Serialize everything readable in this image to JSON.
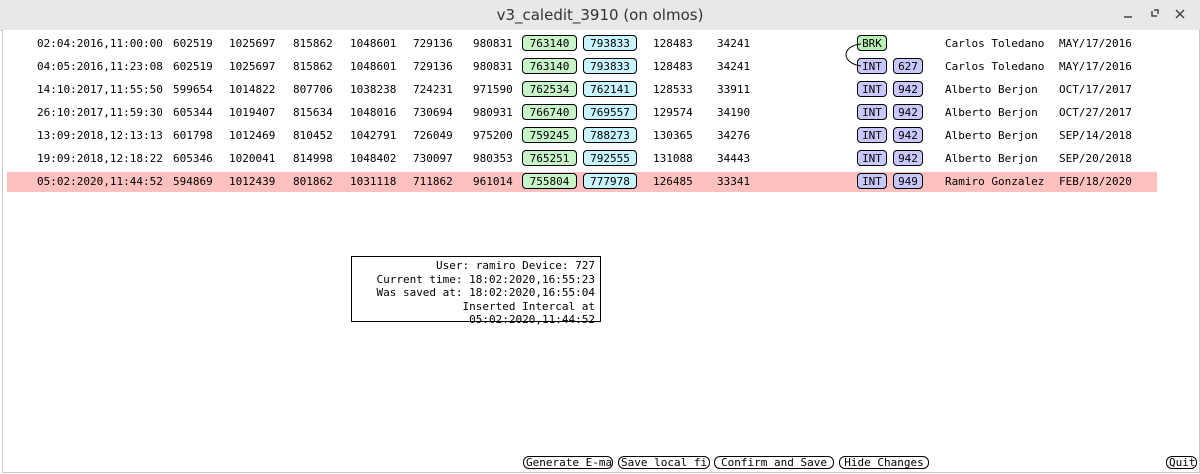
{
  "window": {
    "title": "v3_caledit_3910 (on olmos)"
  },
  "rows": [
    {
      "ts": "02:04:2016,11:00:00",
      "c1": "602519",
      "c2": "1025697",
      "c3": "815862",
      "c4": "1048601",
      "c5": "729136",
      "c6": "980831",
      "g": "763140",
      "cy": "793833",
      "c7": "128483",
      "c8": "34241",
      "tag": "BRK",
      "num": "",
      "name": "Carlos Toledano",
      "date": "MAY/17/2016"
    },
    {
      "ts": "04:05:2016,11:23:08",
      "c1": "602519",
      "c2": "1025697",
      "c3": "815862",
      "c4": "1048601",
      "c5": "729136",
      "c6": "980831",
      "g": "763140",
      "cy": "793833",
      "c7": "128483",
      "c8": "34241",
      "tag": "INT",
      "num": "627",
      "name": "Carlos Toledano",
      "date": "MAY/17/2016"
    },
    {
      "ts": "14:10:2017,11:55:50",
      "c1": "599654",
      "c2": "1014822",
      "c3": "807706",
      "c4": "1038238",
      "c5": "724231",
      "c6": "971590",
      "g": "762534",
      "cy": "762141",
      "c7": "128533",
      "c8": "33911",
      "tag": "INT",
      "num": "942",
      "name": "Alberto Berjon",
      "date": "OCT/17/2017"
    },
    {
      "ts": "26:10:2017,11:59:30",
      "c1": "605344",
      "c2": "1019407",
      "c3": "815634",
      "c4": "1048016",
      "c5": "730694",
      "c6": "980931",
      "g": "766740",
      "cy": "769557",
      "c7": "129574",
      "c8": "34190",
      "tag": "INT",
      "num": "942",
      "name": "Alberto Berjon",
      "date": "OCT/27/2017"
    },
    {
      "ts": "13:09:2018,12:13:13",
      "c1": "601798",
      "c2": "1012469",
      "c3": "810452",
      "c4": "1042791",
      "c5": "726049",
      "c6": "975200",
      "g": "759245",
      "cy": "788273",
      "c7": "130365",
      "c8": "34276",
      "tag": "INT",
      "num": "942",
      "name": "Alberto Berjon",
      "date": "SEP/14/2018"
    },
    {
      "ts": "19:09:2018,12:18:22",
      "c1": "605346",
      "c2": "1020041",
      "c3": "814998",
      "c4": "1048402",
      "c5": "730097",
      "c6": "980353",
      "g": "765251",
      "cy": "792555",
      "c7": "131088",
      "c8": "34443",
      "tag": "INT",
      "num": "942",
      "name": "Alberto Berjon",
      "date": "SEP/20/2018"
    },
    {
      "ts": "05:02:2020,11:44:52",
      "c1": "594869",
      "c2": "1012439",
      "c3": "801862",
      "c4": "1031118",
      "c5": "711862",
      "c6": "961014",
      "g": "755804",
      "cy": "777978",
      "c7": "126485",
      "c8": "33341",
      "tag": "INT",
      "num": "949",
      "name": "Ramiro Gonzalez",
      "date": "FEB/18/2020"
    }
  ],
  "info": {
    "line1": "User: ramiro Device: 727",
    "line2": "Current time: 18:02:2020,16:55:23",
    "line3": "Was saved at: 18:02:2020,16:55:04",
    "line4": "Inserted Intercal at 05:02:2020,11:44:52"
  },
  "buttons": {
    "email": "Generate E-mail",
    "save_local": "Save local file",
    "confirm": "Confirm and Save",
    "hide": "Hide Changes",
    "quit": "Quit"
  },
  "colors": {
    "selected_row": "#ffc0c0",
    "green_pill": "#c8f5c8",
    "cyan_pill": "#c8f5ff",
    "blue_pill": "#c8c8ff"
  }
}
